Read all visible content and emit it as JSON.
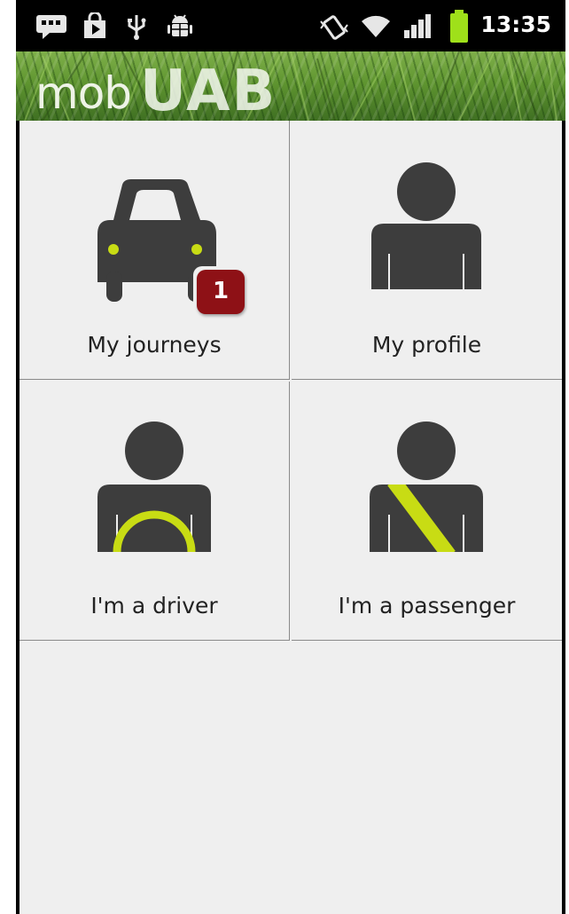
{
  "status_bar": {
    "time": "13:35",
    "icons": [
      "message-icon",
      "shop-icon",
      "usb-icon",
      "android-debug-icon",
      "vibrate-icon",
      "wifi-icon",
      "signal-icon",
      "battery-icon"
    ]
  },
  "header": {
    "logo_prefix": "mob",
    "logo_main": "UAB"
  },
  "tiles": [
    {
      "label": "My journeys",
      "icon": "car-icon",
      "badge": "1"
    },
    {
      "label": "My profile",
      "icon": "person-icon"
    },
    {
      "label": "I'm a driver",
      "icon": "driver-icon"
    },
    {
      "label": "I'm a passenger",
      "icon": "passenger-icon"
    }
  ],
  "colors": {
    "icon_dark": "#3d3d3d",
    "accent": "#c8dc14",
    "badge": "#8e1116",
    "background": "#efefef"
  }
}
